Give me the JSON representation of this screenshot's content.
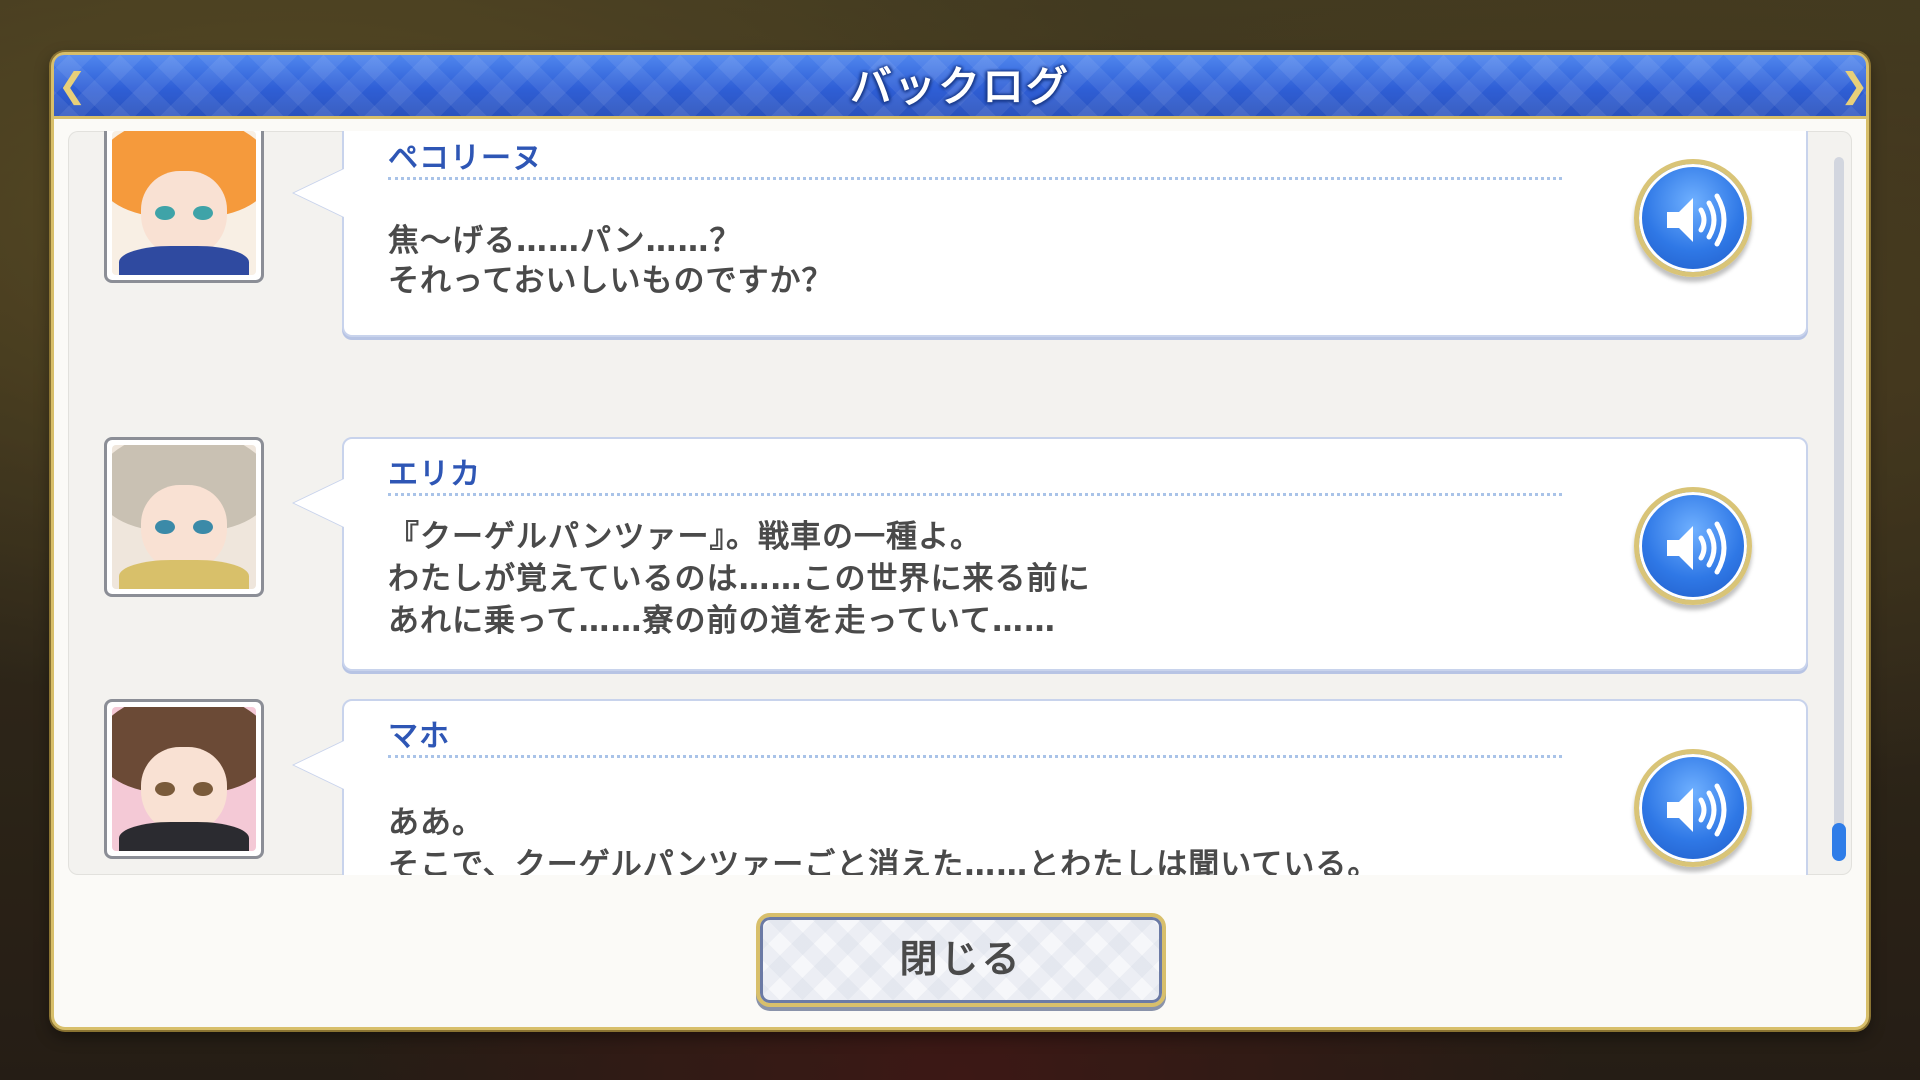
{
  "dialog": {
    "title": "バックログ",
    "close_label": "閉じる"
  },
  "entries": [
    {
      "speaker": "ペコリーヌ",
      "lines": [
        "焦～げる……パン……？",
        "それっておいしいものですか？"
      ],
      "portrait_colors": {
        "hair": "#f59a3c",
        "eyes": "#3fa3a8",
        "outfit": "#2f4aa0"
      }
    },
    {
      "speaker": "エリカ",
      "lines": [
        "『クーゲルパンツァー』。戦車の一種よ。",
        "わたしが覚えているのは……この世界に来る前に",
        "あれに乗って……寮の前の道を走っていて……"
      ],
      "portrait_colors": {
        "hair": "#c9c1b3",
        "eyes": "#3b8aa8",
        "outfit": "#d8c06a"
      }
    },
    {
      "speaker": "マホ",
      "lines": [
        "ああ。",
        "そこで、クーゲルパンツァーごと消えた……とわたしは聞いている。"
      ],
      "portrait_colors": {
        "hair": "#6b4a36",
        "eyes": "#7a5a3a",
        "outfit": "#2b2b30"
      }
    }
  ],
  "icons": {
    "voice": "speaker-volume-icon",
    "corner": "ornament-icon"
  },
  "colors": {
    "title_bar": "#2f5fd6",
    "gold_border": "#d8bf6b",
    "speaker_name": "#2e56b5",
    "scroll_thumb": "#2f7de8"
  }
}
